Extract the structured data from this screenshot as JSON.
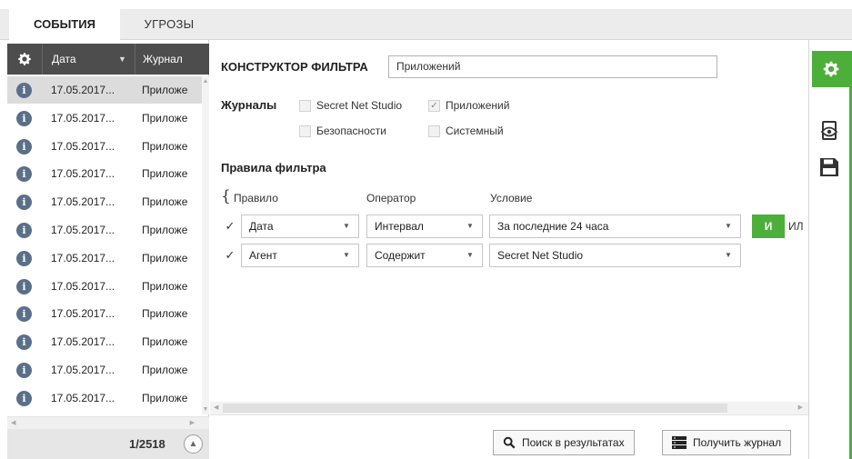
{
  "tabs": [
    {
      "label": "СОБЫТИЯ"
    },
    {
      "label": "УГРОЗЫ"
    }
  ],
  "events": {
    "columns": {
      "date": "Дата",
      "journal": "Журнал"
    },
    "rows": [
      {
        "date": "17.05.2017...",
        "journal": "Приложе"
      },
      {
        "date": "17.05.2017...",
        "journal": "Приложе"
      },
      {
        "date": "17.05.2017...",
        "journal": "Приложе"
      },
      {
        "date": "17.05.2017...",
        "journal": "Приложе"
      },
      {
        "date": "17.05.2017...",
        "journal": "Приложе"
      },
      {
        "date": "17.05.2017...",
        "journal": "Приложе"
      },
      {
        "date": "17.05.2017...",
        "journal": "Приложе"
      },
      {
        "date": "17.05.2017...",
        "journal": "Приложе"
      },
      {
        "date": "17.05.2017...",
        "journal": "Приложе"
      },
      {
        "date": "17.05.2017...",
        "journal": "Приложе"
      },
      {
        "date": "17.05.2017...",
        "journal": "Приложе"
      },
      {
        "date": "17.05.2017...",
        "journal": "Приложе"
      }
    ],
    "pagination": "1/2518"
  },
  "filter": {
    "title": "КОНСТРУКТОР ФИЛЬТРА",
    "name_value": "Приложений",
    "journals_label": "Журналы",
    "journals": [
      {
        "label": "Secret Net Studio",
        "checked": false
      },
      {
        "label": "Приложений",
        "checked": true
      },
      {
        "label": "Безопасности",
        "checked": false
      },
      {
        "label": "Системный",
        "checked": false
      }
    ],
    "rules_label": "Правила фильтра",
    "headers": {
      "rule": "Правило",
      "operator": "Оператор",
      "condition": "Условие"
    },
    "rules": [
      {
        "checked": true,
        "rule": "Дата",
        "operator": "Интервал",
        "condition": "За последние 24 часа"
      },
      {
        "checked": true,
        "rule": "Агент",
        "operator": "Содержит",
        "condition": "Secret Net Studio"
      }
    ],
    "and_label": "И",
    "or_label": "ИЛ"
  },
  "footer": {
    "search_label": "Поиск в результатах",
    "get_journal_label": "Получить журнал"
  },
  "colors": {
    "accent": "#4caf3a",
    "header": "#4d4d4d",
    "info": "#5a6f88"
  }
}
